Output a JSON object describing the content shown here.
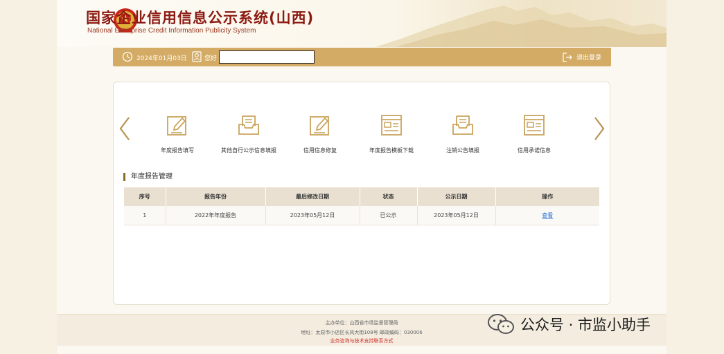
{
  "header": {
    "title": "国家企业信用信息公示系统(山西)",
    "subtitle": "National Enterprise Credit Information Publicity System"
  },
  "toolbar": {
    "date": "2024年01月03日",
    "greeting": "您好",
    "username": "",
    "logout_label": "退出登录"
  },
  "functions": [
    {
      "label": "年度报告填写",
      "icon": "pen-doc-icon"
    },
    {
      "label": "其他自行公示信息填报",
      "icon": "inbox-doc-icon"
    },
    {
      "label": "信用信息修复",
      "icon": "pen-doc-icon"
    },
    {
      "label": "年度报告模板下载",
      "icon": "template-doc-icon"
    },
    {
      "label": "注销公告填报",
      "icon": "inbox-doc-icon"
    },
    {
      "label": "信用承诺信息",
      "icon": "template-doc-icon"
    }
  ],
  "section": {
    "title": "年度报告管理"
  },
  "table": {
    "columns": [
      "序号",
      "报告年份",
      "最后修改日期",
      "状态",
      "公示日期",
      "操作"
    ],
    "rows": [
      {
        "no": "1",
        "year": "2022年年度报告",
        "modified": "2023年05月12日",
        "status": "已公示",
        "published": "2023年05月12日",
        "action": "查看"
      }
    ]
  },
  "footer": {
    "sponsor": "主办单位：山西省市场监督管理局",
    "address": "地址：太原市小店区长风大街108号 邮政编码：030006",
    "support": "业务咨询与技术支持联系方式"
  },
  "watermark": {
    "text": "公众号 · 市监小助手"
  },
  "colors": {
    "brand": "#8b1a12",
    "toolbar": "#d3ab64",
    "link": "#2a6fd6",
    "icon": "#c9a45c"
  }
}
